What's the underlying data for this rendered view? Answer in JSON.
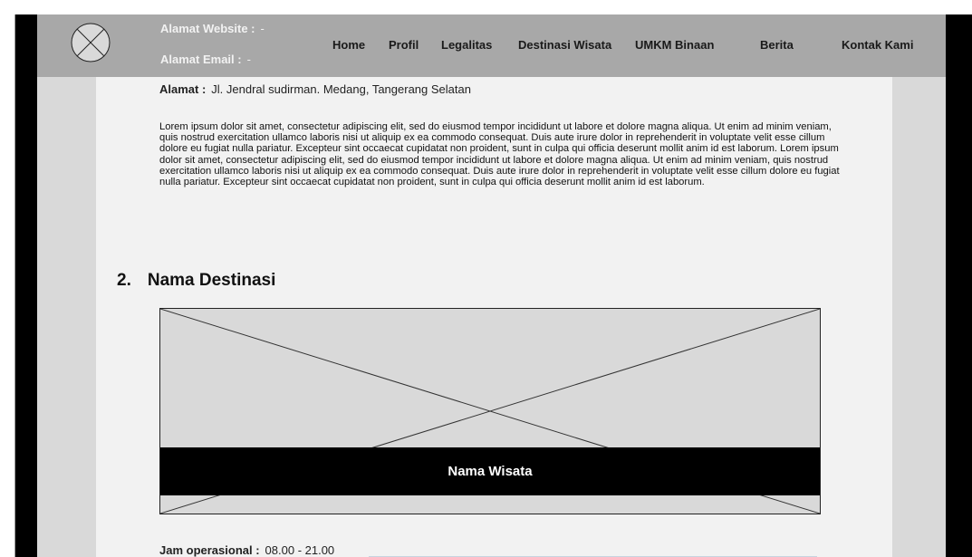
{
  "header": {
    "website_label": "Alamat Website :",
    "website_value": "-",
    "email_label": "Alamat Email :",
    "email_value": "-",
    "logo_icon": "logo-placeholder-icon"
  },
  "nav": {
    "items": [
      {
        "label": "Home"
      },
      {
        "label": "Profil"
      },
      {
        "label": "Legalitas"
      },
      {
        "label": "Destinasi Wisata"
      },
      {
        "label": "UMKM Binaan"
      },
      {
        "label": "Berita"
      },
      {
        "label": "Kontak Kami"
      }
    ]
  },
  "main": {
    "address_label": "Alamat :",
    "address_value": "Jl. Jendral sudirman. Medang, Tangerang Selatan",
    "description": "Lorem ipsum dolor sit amet, consectetur adipiscing elit, sed do eiusmod tempor incididunt ut labore et dolore magna aliqua. Ut enim ad minim veniam, quis nostrud exercitation ullamco laboris nisi ut aliquip ex ea commodo consequat. Duis aute irure dolor in reprehenderit in voluptate velit esse cillum dolore eu fugiat nulla pariatur. Excepteur sint occaecat cupidatat non proident, sunt in culpa qui officia deserunt mollit anim id est laborum. Lorem ipsum dolor sit amet, consectetur adipiscing elit, sed do eiusmod tempor incididunt ut labore et dolore magna aliqua. Ut enim ad minim veniam, quis nostrud exercitation ullamco laboris nisi ut aliquip ex ea commodo consequat. Duis aute irure dolor in reprehenderit in voluptate velit esse cillum dolore eu fugiat nulla pariatur. Excepteur sint occaecat cupidatat non proident, sunt in culpa qui officia deserunt mollit anim id est laborum.",
    "section_number": "2.",
    "section_title": "Nama Destinasi",
    "image_caption": "Nama Wisata",
    "hours_label": "Jam operasional :",
    "hours_value": "08.00 - 21.00"
  },
  "colors": {
    "header_bg": "#a8a8a8",
    "content_bg": "#f2f2f2",
    "gutter_bg": "#d9d9d9",
    "frame_bg": "#000000",
    "caption_bg": "#000000"
  }
}
